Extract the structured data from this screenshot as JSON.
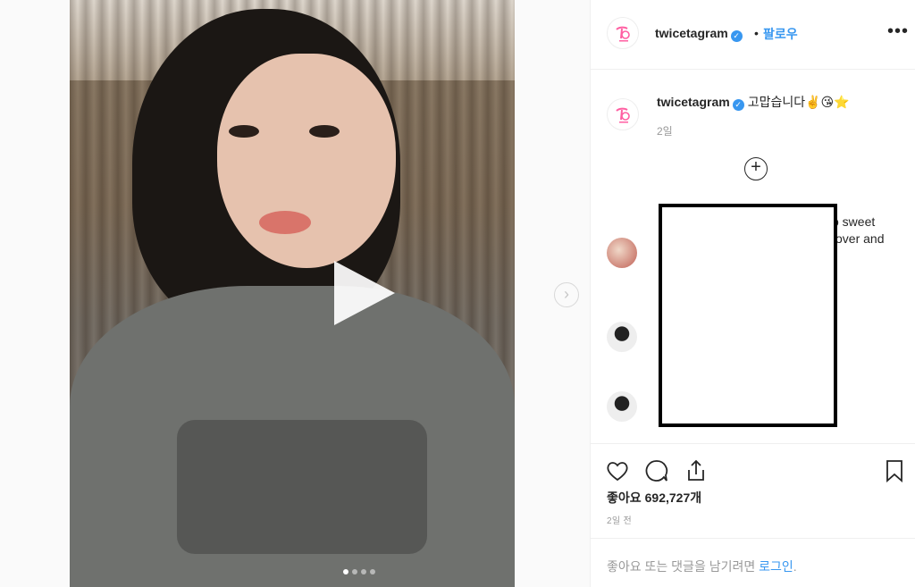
{
  "post": {
    "username": "twicetagram",
    "follow_label": "팔로우",
    "bullet": "•",
    "more_icon": "more-horizontal-icon",
    "caption_text": "고맙습니다✌️😘⭐",
    "caption_time": "2일",
    "likes_label": "좋아요",
    "likes_count": "692,727개",
    "post_time": "2일 전"
  },
  "comments": {
    "fragment_1": "o sweet",
    "fragment_2": "over and"
  },
  "login": {
    "prefix": "좋아요 또는 댓글을 남기려면 ",
    "link": "로그인",
    "suffix": "."
  },
  "media": {
    "carousel_index": 1,
    "carousel_total": 4
  },
  "colors": {
    "accent": "#3897f0",
    "brand": "#ff5fa2",
    "border": "#efefef",
    "muted": "#999999"
  }
}
